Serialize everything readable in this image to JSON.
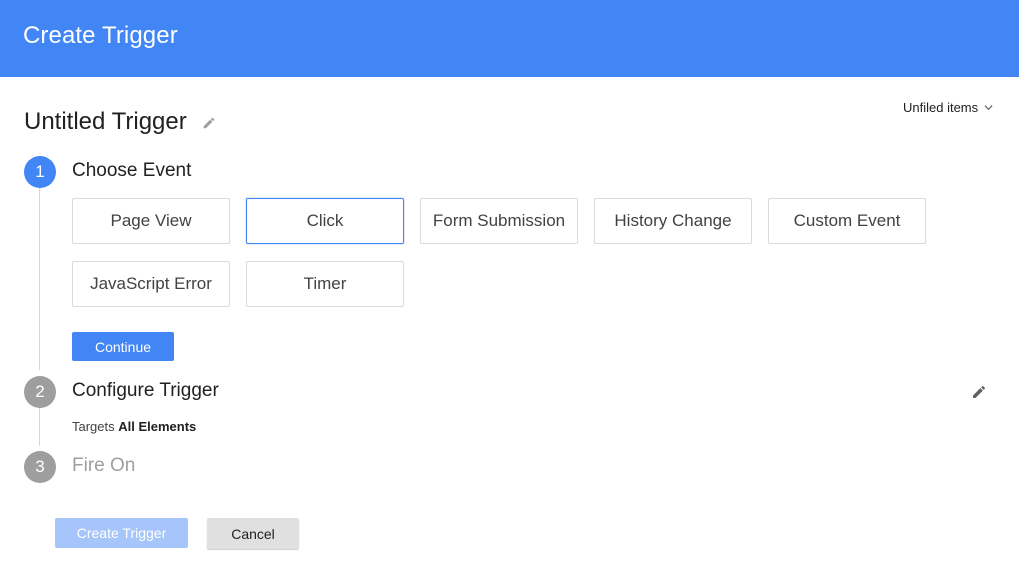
{
  "header": {
    "title": "Create Trigger"
  },
  "trigger": {
    "name": "Untitled Trigger",
    "name_edit_icon": "pencil-icon"
  },
  "folder": {
    "label": "Unfiled items",
    "icon": "chevron-down-icon"
  },
  "steps": [
    {
      "number": "1",
      "title": "Choose Event",
      "state": "active"
    },
    {
      "number": "2",
      "title": "Configure Trigger",
      "state": "inactive"
    },
    {
      "number": "3",
      "title": "Fire On",
      "state": "disabled"
    }
  ],
  "events": [
    {
      "label": "Page View",
      "selected": false
    },
    {
      "label": "Click",
      "selected": true
    },
    {
      "label": "Form Submission",
      "selected": false
    },
    {
      "label": "History Change",
      "selected": false
    },
    {
      "label": "Custom Event",
      "selected": false
    },
    {
      "label": "JavaScript Error",
      "selected": false
    },
    {
      "label": "Timer",
      "selected": false
    }
  ],
  "continue_label": "Continue",
  "configure": {
    "targets_prefix": "Targets",
    "targets_value": "All Elements",
    "edit_icon": "pencil-icon"
  },
  "footer": {
    "create_label": "Create Trigger",
    "cancel_label": "Cancel"
  },
  "colors": {
    "primary": "#4285f4",
    "primary_disabled": "#a6c5fa",
    "step_inactive": "#9e9e9e",
    "divider": "#dadada"
  }
}
